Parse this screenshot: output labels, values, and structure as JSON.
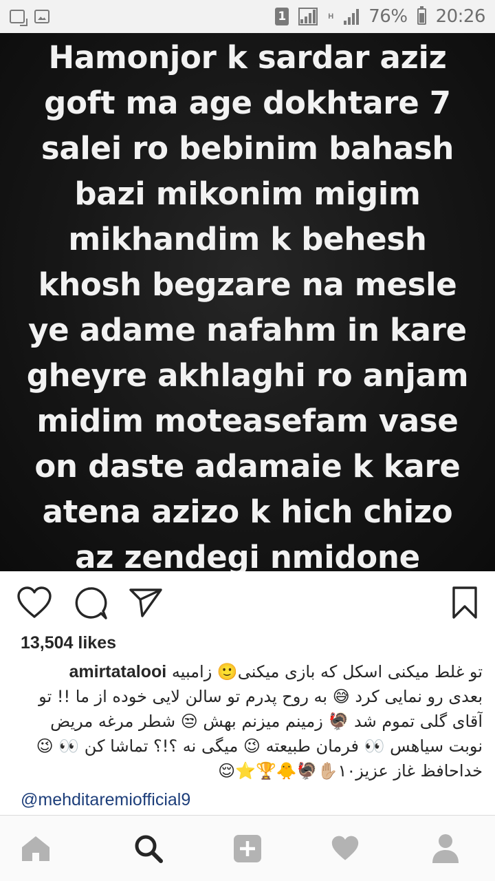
{
  "status_bar": {
    "sim_label": "1",
    "network_label": "H",
    "battery_text": "76%",
    "time": "20:26",
    "icons": [
      "notification-icon",
      "gallery-icon",
      "signal-icon",
      "battery-icon"
    ]
  },
  "post": {
    "image_text_lines": [
      "Hamonjor k sardar aziz",
      "goft ma age dokhtare 7",
      "salei ro bebinim bahash",
      "bazi mikonim migim",
      "mikhandim k behesh",
      "khosh begzare na mesle",
      "ye adame nafahm in kare",
      "gheyre akhlaghi ro anjam",
      "midim moteasefam vase",
      "on daste adamaie k kare",
      "atena azizo k hich chizo",
      "az zendegi nmidone"
    ],
    "likes": "13,504 likes",
    "username": "amirtatalooi",
    "caption_lines": [
      "تو غلط میکنی اسکل که بازی میکنی🙂 زامبیه",
      "بعدی رو نمایی کرد 😅 به روح پدرم تو سالن لایی خوده از ما !! تو",
      "آقای گلی تموم شد 🦃 زمینم میزنم بهش 😒 شطر مرغه مریض",
      "نوبت سیاهس 👀 فرمان طبیعته 😉 میگی نه ؟!؟ تماشا کن 👀 😉",
      "خداحافظ غاز عزیز۱۰✋🏼🦃🐥🏆⭐😌"
    ],
    "mention": "@mehditaremiofficial9"
  },
  "actions": {
    "icons": [
      "heart-icon",
      "comment-icon",
      "share-icon",
      "bookmark-icon"
    ]
  },
  "bottom_nav": {
    "icons": [
      "home-icon",
      "search-icon",
      "add-post-icon",
      "activity-heart-icon",
      "profile-icon"
    ]
  }
}
